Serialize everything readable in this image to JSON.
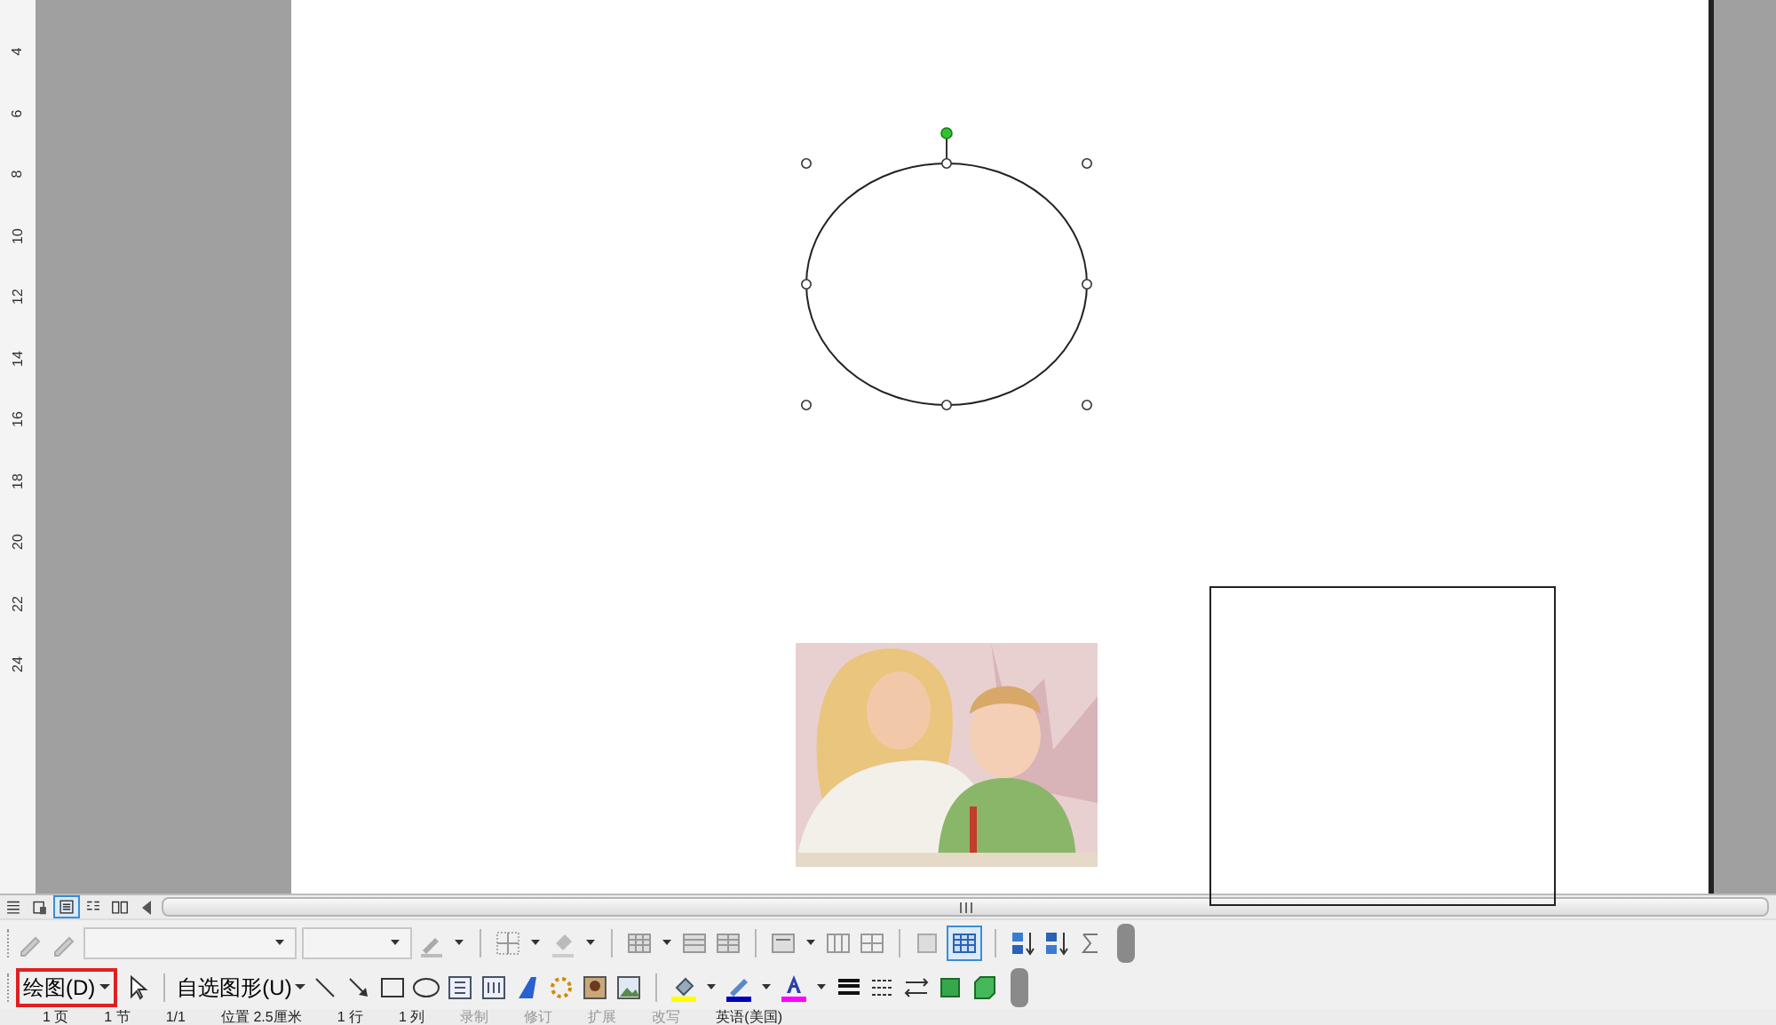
{
  "ruler": {
    "marks": [
      "4",
      "6",
      "8",
      "10",
      "12",
      "14",
      "16",
      "18",
      "20",
      "22",
      "24"
    ]
  },
  "canvas": {
    "shapes": [
      {
        "kind": "ellipse",
        "selected": true
      },
      {
        "kind": "picture"
      },
      {
        "kind": "rectangle",
        "selected": false
      }
    ]
  },
  "view_buttons": [
    {
      "selected": false
    },
    {
      "selected": false
    },
    {
      "selected": true
    },
    {
      "selected": false
    },
    {
      "selected": false
    }
  ],
  "drawing_toolbar": {
    "draw_menu": {
      "label": "绘图(D)",
      "highlighted": true
    },
    "autoshapes_menu": {
      "label": "自选图形(U)"
    }
  },
  "status_bar": [
    "1 页",
    "1 节",
    "1/1",
    "位置 2.5厘米",
    "1 行",
    "1 列",
    "录制",
    "修订",
    "扩展",
    "改写",
    "英语(美国)"
  ]
}
